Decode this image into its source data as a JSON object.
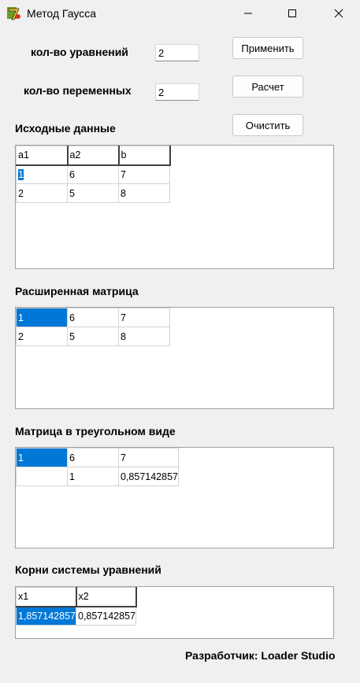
{
  "window": {
    "title": "Метод Гаусса"
  },
  "controls": {
    "equations_label": "кол-во уравнений",
    "equations_value": "2",
    "variables_label": "кол-во переменных",
    "variables_value": "2",
    "apply_button": "Применить",
    "calc_button": "Расчет",
    "clear_button": "Очистить"
  },
  "source_data": {
    "title": "Исходные данные",
    "headers": [
      "a1",
      "a2",
      "b"
    ],
    "rows": [
      [
        "1",
        "6",
        "7"
      ],
      [
        "2",
        "5",
        "8"
      ]
    ]
  },
  "extended_matrix": {
    "title": "Расширенная матрица",
    "rows": [
      [
        "1",
        "6",
        "7"
      ],
      [
        "2",
        "5",
        "8"
      ]
    ]
  },
  "triangular_matrix": {
    "title": "Матрица в треугольном виде",
    "rows": [
      [
        "1",
        "6",
        "7"
      ],
      [
        "",
        "1",
        "0,857142857"
      ]
    ]
  },
  "roots": {
    "title": "Корни системы уравнений",
    "headers": [
      "x1",
      "x2"
    ],
    "rows": [
      [
        "1,857142857",
        "0,857142857"
      ]
    ]
  },
  "footer": {
    "developer": "Разработчик: Loader Studio"
  },
  "colors": {
    "selection": "#0078d7",
    "background": "#f0f0f0"
  }
}
